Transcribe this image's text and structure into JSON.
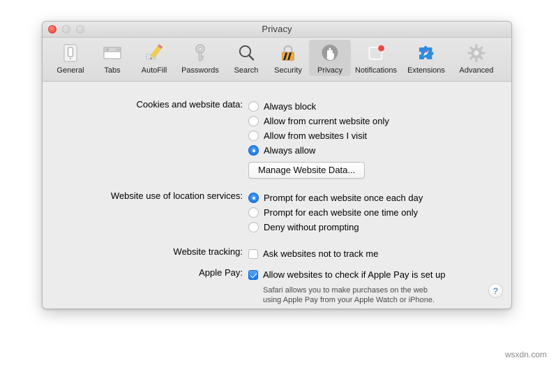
{
  "window": {
    "title": "Privacy",
    "traffic_lights": [
      {
        "name": "close",
        "color": "#f2584f"
      },
      {
        "name": "minimize",
        "color": "#d2d2d2"
      },
      {
        "name": "zoom",
        "color": "#d2d2d2"
      }
    ]
  },
  "toolbar": {
    "items": [
      {
        "label": "General",
        "icon": "general-icon",
        "selected": false
      },
      {
        "label": "Tabs",
        "icon": "tabs-icon",
        "selected": false
      },
      {
        "label": "AutoFill",
        "icon": "autofill-pencil-icon",
        "selected": false
      },
      {
        "label": "Passwords",
        "icon": "key-icon",
        "selected": false
      },
      {
        "label": "Search",
        "icon": "magnifier-icon",
        "selected": false
      },
      {
        "label": "Security",
        "icon": "padlock-icon",
        "selected": false
      },
      {
        "label": "Privacy",
        "icon": "hand-icon",
        "selected": true
      },
      {
        "label": "Notifications",
        "icon": "notification-badge-icon",
        "selected": false
      },
      {
        "label": "Extensions",
        "icon": "puzzle-compass-icon",
        "selected": false
      },
      {
        "label": "Advanced",
        "icon": "gear-icon",
        "selected": false
      }
    ]
  },
  "sections": {
    "cookies": {
      "label": "Cookies and website data:",
      "options": [
        {
          "label": "Always block",
          "selected": false
        },
        {
          "label": "Allow from current website only",
          "selected": false
        },
        {
          "label": "Allow from websites I visit",
          "selected": false
        },
        {
          "label": "Always allow",
          "selected": true
        }
      ],
      "button": "Manage Website Data..."
    },
    "location": {
      "label": "Website use of location services:",
      "options": [
        {
          "label": "Prompt for each website once each day",
          "selected": true
        },
        {
          "label": "Prompt for each website one time only",
          "selected": false
        },
        {
          "label": "Deny without prompting",
          "selected": false
        }
      ]
    },
    "tracking": {
      "label": "Website tracking:",
      "checkbox": {
        "label": "Ask websites not to track me",
        "checked": false
      }
    },
    "apple_pay": {
      "label": "Apple Pay:",
      "checkbox": {
        "label": "Allow websites to check if Apple Pay is set up",
        "checked": true
      },
      "note_line1": "Safari allows you to make purchases on the web",
      "note_line2": "using Apple Pay from your Apple Watch or iPhone."
    }
  },
  "help": {
    "label": "?"
  },
  "watermark": {
    "text": "wsxdn.com"
  },
  "colors": {
    "accent": "#1278ef",
    "window_bg": "#ececec",
    "toolbar_bg": "#e0e0e0"
  }
}
